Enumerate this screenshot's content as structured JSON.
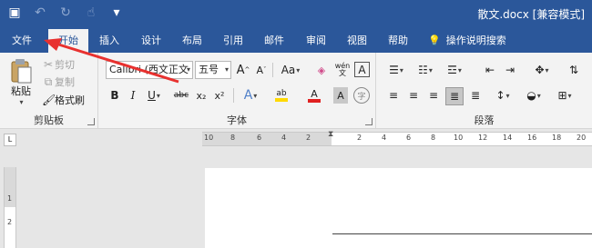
{
  "window": {
    "title": "散文.docx [兼容模式]"
  },
  "qat": {
    "save": "save-icon",
    "undo": "undo-icon",
    "redo": "redo-icon",
    "touch": "touch-mode-icon",
    "customize": "customize-icon"
  },
  "tabs": [
    {
      "label": "文件"
    },
    {
      "label": "开始"
    },
    {
      "label": "插入"
    },
    {
      "label": "设计"
    },
    {
      "label": "布局"
    },
    {
      "label": "引用"
    },
    {
      "label": "邮件"
    },
    {
      "label": "审阅"
    },
    {
      "label": "视图"
    },
    {
      "label": "帮助"
    }
  ],
  "tell_me": {
    "label": "操作说明搜索"
  },
  "clipboard": {
    "paste": "粘贴",
    "cut": "剪切",
    "copy": "复制",
    "format_painter": "格式刷",
    "label": "剪贴板"
  },
  "font": {
    "name": "Calibri (西文正文",
    "size": "五号",
    "grow": "A",
    "shrink": "A",
    "case": "Aa",
    "bold": "B",
    "italic": "I",
    "underline": "U",
    "strike": "abc",
    "sub": "x₂",
    "sup": "x²",
    "effects": "A",
    "highlight": "ab",
    "color": "A",
    "shade": "A",
    "circle": "字",
    "pinyin": "wén",
    "border": "A",
    "label": "字体"
  },
  "paragraph": {
    "label": "段落"
  },
  "ruler": {
    "corner": "L",
    "numbers": [
      "10",
      "8",
      "6",
      "4",
      "2",
      "2",
      "4",
      "6",
      "8",
      "10",
      "12",
      "14",
      "16",
      "18",
      "20"
    ],
    "vnumbers": [
      "1",
      "2"
    ]
  },
  "colors": {
    "accent": "#2b579a",
    "arrow": "#e8312f",
    "highlight": "#ffd900",
    "font_color": "#e02020"
  }
}
